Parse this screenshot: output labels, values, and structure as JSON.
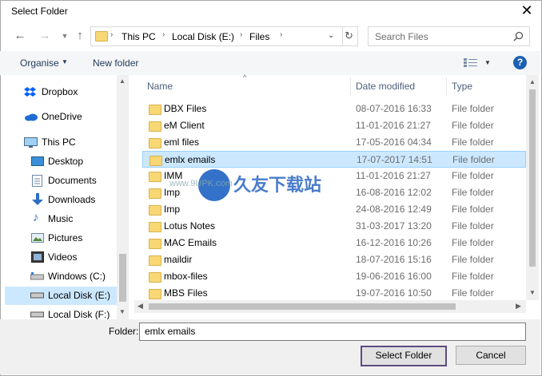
{
  "window": {
    "title": "Select Folder"
  },
  "address": {
    "segments": [
      "This PC",
      "Local Disk (E:)",
      "Files"
    ]
  },
  "search": {
    "placeholder": "Search Files"
  },
  "toolbar": {
    "organise": "Organise",
    "new_folder": "New folder"
  },
  "sidebar": {
    "items": [
      {
        "label": "Dropbox",
        "icon": "dropbox-icon"
      },
      {
        "label": "OneDrive",
        "icon": "onedrive-icon"
      },
      {
        "label": "This PC",
        "icon": "computer-icon"
      },
      {
        "label": "Desktop",
        "icon": "desktop-icon"
      },
      {
        "label": "Documents",
        "icon": "documents-icon"
      },
      {
        "label": "Downloads",
        "icon": "downloads-icon"
      },
      {
        "label": "Music",
        "icon": "music-icon"
      },
      {
        "label": "Pictures",
        "icon": "pictures-icon"
      },
      {
        "label": "Videos",
        "icon": "videos-icon"
      },
      {
        "label": "Windows (C:)",
        "icon": "drive-icon"
      },
      {
        "label": "Local Disk (E:)",
        "icon": "drive-icon",
        "selected": true
      },
      {
        "label": "Local Disk (F:)",
        "icon": "drive-icon"
      }
    ]
  },
  "columns": {
    "name": "Name",
    "date": "Date modified",
    "type": "Type"
  },
  "files": [
    {
      "name": "DBX Files",
      "date": "08-07-2016 16:33",
      "type": "File folder"
    },
    {
      "name": "eM Client",
      "date": "11-01-2016 21:27",
      "type": "File folder"
    },
    {
      "name": "eml files",
      "date": "17-05-2016 04:34",
      "type": "File folder"
    },
    {
      "name": "emlx emails",
      "date": "17-07-2017 14:51",
      "type": "File folder",
      "selected": true
    },
    {
      "name": "IMM",
      "date": "11-01-2016 21:27",
      "type": "File folder"
    },
    {
      "name": "Imp",
      "date": "16-08-2016 12:02",
      "type": "File folder"
    },
    {
      "name": "Imp",
      "date": "24-08-2016 12:49",
      "type": "File folder"
    },
    {
      "name": "Lotus Notes",
      "date": "31-03-2017 13:20",
      "type": "File folder"
    },
    {
      "name": "MAC Emails",
      "date": "16-12-2016 10:26",
      "type": "File folder"
    },
    {
      "name": "maildir",
      "date": "18-07-2016 15:16",
      "type": "File folder"
    },
    {
      "name": "mbox-files",
      "date": "19-06-2016 16:00",
      "type": "File folder"
    },
    {
      "name": "MBS Files",
      "date": "19-07-2016 10:50",
      "type": "File folder"
    }
  ],
  "footer": {
    "folder_label": "Folder:",
    "folder_value": "emlx emails",
    "select_button": "Select Folder",
    "cancel_button": "Cancel"
  },
  "watermark": {
    "text": "久友下载站",
    "url": "www.9UPK.com"
  }
}
